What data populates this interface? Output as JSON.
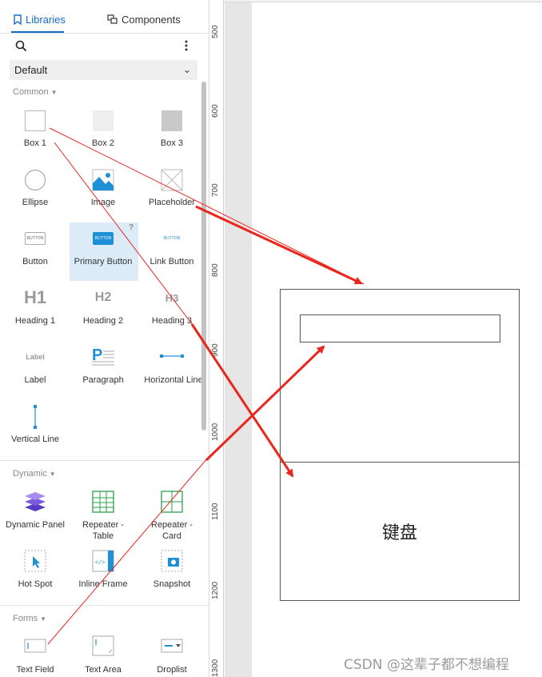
{
  "tabs": {
    "libraries": "Libraries",
    "components": "Components"
  },
  "library_select": {
    "value": "Default"
  },
  "sections": {
    "common": "Common",
    "dynamic": "Dynamic",
    "forms": "Forms"
  },
  "widgets": {
    "box1": "Box 1",
    "box2": "Box 2",
    "box3": "Box 3",
    "ellipse": "Ellipse",
    "image": "Image",
    "placeholder": "Placeholder",
    "button": "Button",
    "primary_button": "Primary Button",
    "link_button": "Link Button",
    "heading1": "Heading 1",
    "heading2": "Heading 2",
    "heading3": "Heading 3",
    "label": "Label",
    "paragraph": "Paragraph",
    "horizontal_line": "Horizontal Line",
    "vertical_line": "Vertical Line",
    "dynamic_panel": "Dynamic Panel",
    "repeater_table_1": "Repeater -",
    "repeater_table_2": "Table",
    "repeater_card_1": "Repeater -",
    "repeater_card_2": "Card",
    "hot_spot": "Hot Spot",
    "inline_frame": "Inline Frame",
    "snapshot": "Snapshot",
    "text_field": "Text Field",
    "text_area": "Text Area",
    "droplist": "Droplist"
  },
  "icon_text": {
    "button_text": "BUTTON",
    "h1": "H1",
    "h2": "H2",
    "h3": "H3",
    "label": "Label",
    "paragraph_p": "P",
    "help": "?"
  },
  "ruler": {
    "t500": "500",
    "t600": "600",
    "t700": "700",
    "t800": "800",
    "t900": "900",
    "t1000": "1000",
    "t1100": "1100",
    "t1200": "1200",
    "t1300": "1300"
  },
  "canvas": {
    "keyboard_label": "键盘"
  },
  "watermark": "CSDN @这辈子都不想编程",
  "colors": {
    "accent": "#1769c8",
    "arrow": "#e8271e",
    "selected": "#dcebf8",
    "icon_blue": "#1f8fd6"
  }
}
